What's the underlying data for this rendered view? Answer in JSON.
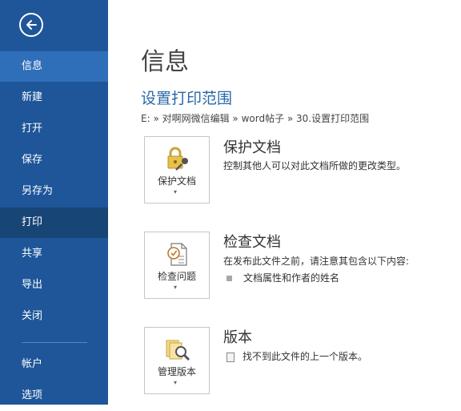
{
  "sidebar": {
    "back_icon": "back-arrow-icon",
    "items": [
      {
        "label": "信息"
      },
      {
        "label": "新建"
      },
      {
        "label": "打开"
      },
      {
        "label": "保存"
      },
      {
        "label": "另存为"
      },
      {
        "label": "打印"
      },
      {
        "label": "共享"
      },
      {
        "label": "导出"
      },
      {
        "label": "关闭"
      },
      {
        "label": "帐户"
      },
      {
        "label": "选项"
      }
    ]
  },
  "main": {
    "title": "信息",
    "doc_title": "设置打印范围",
    "path": "E: » 对啊网微信编辑 » word帖子 » 30.设置打印范围"
  },
  "sections": {
    "protect": {
      "button_label": "保护文档",
      "title": "保护文档",
      "desc": "控制其他人可以对此文档所做的更改类型。",
      "icon": "lock-key-icon"
    },
    "inspect": {
      "button_label": "检查问题",
      "title": "检查文档",
      "desc": "在发布此文件之前，请注意其包含以下内容:",
      "bullet": "文档属性和作者的姓名",
      "icon": "inspect-document-icon"
    },
    "versions": {
      "button_label": "管理版本",
      "title": "版本",
      "desc": "找不到此文件的上一个版本。",
      "icon": "manage-versions-icon"
    }
  },
  "colors": {
    "sidebar": "#1e5699",
    "sidebar_active": "#2f6fba",
    "sidebar_current": "#174576",
    "accent_text": "#2a68a8"
  }
}
